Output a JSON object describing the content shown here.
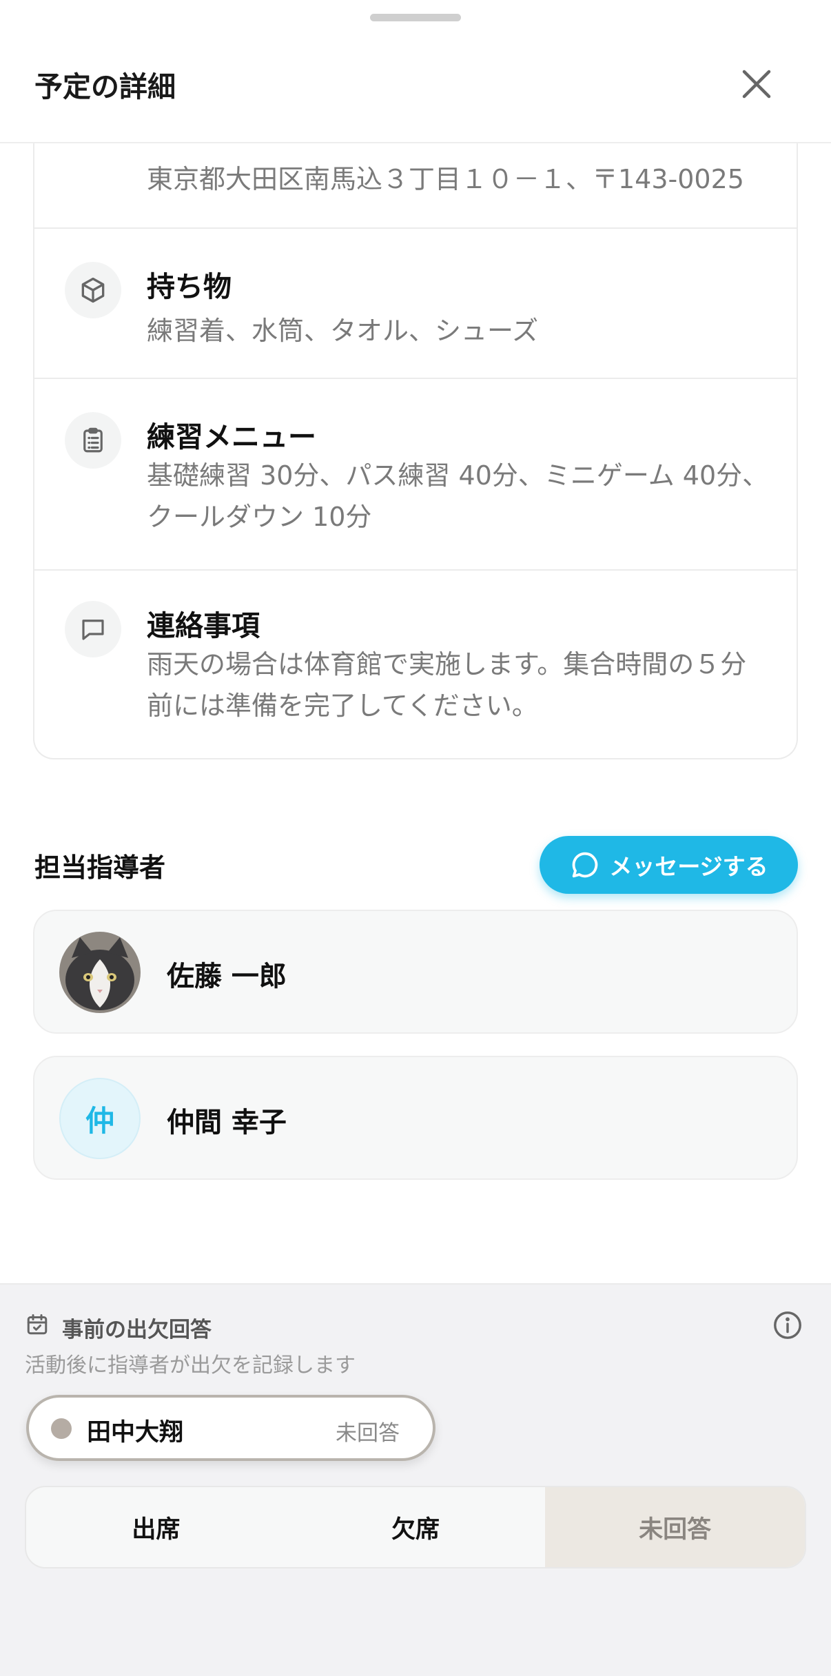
{
  "header": {
    "title": "予定の詳細"
  },
  "details": [
    {
      "icon": "location-pin-icon",
      "title": "",
      "text": "東京都大田区南馬込３丁目１０－１、〒143-0025"
    },
    {
      "icon": "box-icon",
      "title": "持ち物",
      "text": "練習着、水筒、タオル、シューズ"
    },
    {
      "icon": "clipboard-icon",
      "title": "練習メニュー",
      "text": "基礎練習 30分、パス練習 40分、ミニゲーム 40分、クールダウン 10分"
    },
    {
      "icon": "chat-bubble-icon",
      "title": "連絡事項",
      "text": "雨天の場合は体育館で実施します。集合時間の５分前には準備を完了してください。"
    }
  ],
  "coaches_section": {
    "title": "担当指導者",
    "message_button": "メッセージする",
    "coaches": [
      {
        "name": "佐藤 一郎",
        "avatar": "cat-photo"
      },
      {
        "name": "仲間 幸子",
        "avatar_initial": "仲"
      }
    ]
  },
  "attendance": {
    "title": "事前の出欠回答",
    "subtitle": "活動後に指導者が出欠を記録します",
    "child": {
      "name": "田中大翔",
      "status": "未回答"
    },
    "options": [
      "出席",
      "欠席",
      "未回答"
    ],
    "selected": "未回答"
  },
  "colors": {
    "accent": "#1fb8e6",
    "selected_segment": "#ece8e2"
  }
}
